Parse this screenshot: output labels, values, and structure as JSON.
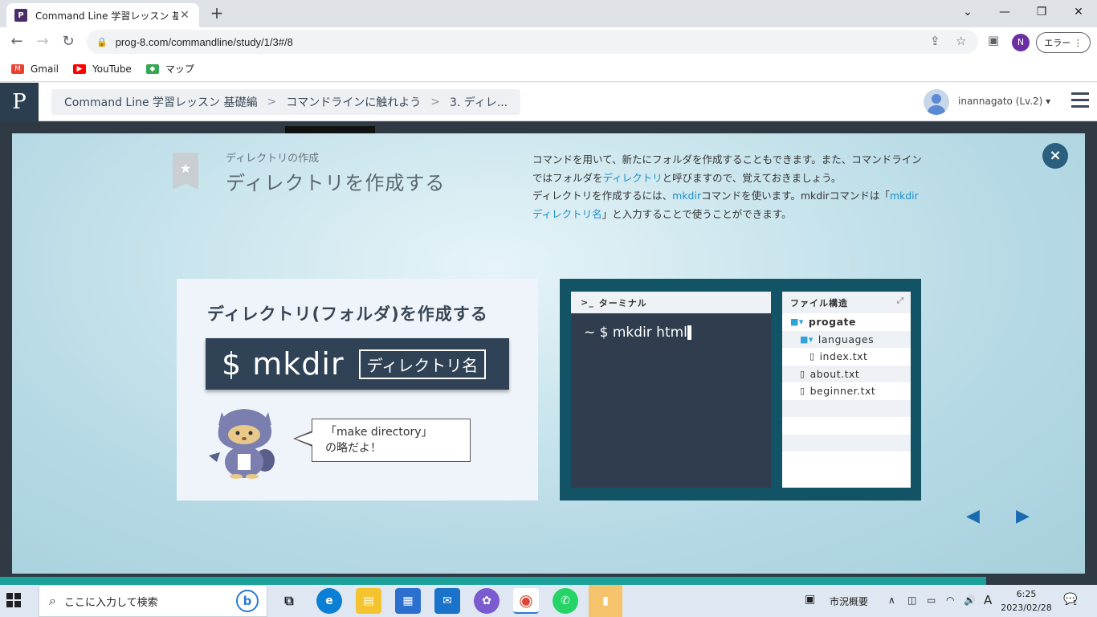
{
  "browser": {
    "tab_title": "Command Line 学習レッスン 基礎編 | Progate",
    "tab_close": "✕",
    "new_tab": "+",
    "url": "prog-8.com/commandline/study/1/3#/8",
    "error_button": "エラー",
    "profile_initial": "N",
    "window": {
      "minimize": "—",
      "maximize": "❐",
      "close": "✕",
      "tabsearch": "⌄"
    },
    "bookmarks": [
      {
        "label": "Gmail",
        "icon": "gmail-icon",
        "color": "#ea4335"
      },
      {
        "label": "YouTube",
        "icon": "youtube-icon",
        "color": "#ff0000"
      },
      {
        "label": "マップ",
        "icon": "maps-icon",
        "color": "#34a853"
      }
    ]
  },
  "app": {
    "logo": "P",
    "breadcrumb": [
      "Command Line 学習レッスン 基礎編",
      "コマンドラインに触れよう",
      "3. ディレ..."
    ],
    "username": "inannagato (Lv.2) ▾"
  },
  "slide": {
    "subtitle": "ディレクトリの作成",
    "title": "ディレクトリを作成する",
    "desc": {
      "p1_a": "コマンドを用いて、新たにフォルダを作成することもできます。また、コマンドラインではフォルダを",
      "p1_link": "ディレクトリ",
      "p1_b": "と呼びますので、覚えておきましょう。",
      "p2_a": "ディレクトリを作成するには、",
      "p2_link1": "mkdir",
      "p2_b": "コマンドを使います。mkdirコマンドは「",
      "p2_link2": "mkdir ディレクトリ名",
      "p2_c": "」と入力することで使うことができます。"
    },
    "left_heading": "ディレクトリ(フォルダ)を作成する",
    "command": "$ mkdir",
    "command_arg": "ディレクトリ名",
    "bubble_line1": "「make directory」",
    "bubble_line2": "の略だよ！",
    "terminal_title": "ターミナル",
    "terminal_prompt": "~ $ mkdir html",
    "files_title": "ファイル構造",
    "files": [
      {
        "name": "progate",
        "type": "folder",
        "level": 0
      },
      {
        "name": "languages",
        "type": "folder",
        "level": 1
      },
      {
        "name": "index.txt",
        "type": "file",
        "level": 2
      },
      {
        "name": "about.txt",
        "type": "file",
        "level": 1
      },
      {
        "name": "beginner.txt",
        "type": "file",
        "level": 1
      },
      {
        "name": "",
        "type": "empty",
        "level": 0
      },
      {
        "name": "",
        "type": "empty",
        "level": 0
      },
      {
        "name": "",
        "type": "empty",
        "level": 0
      },
      {
        "name": "",
        "type": "empty",
        "level": 0
      }
    ],
    "close_label": "×",
    "prev": "◀",
    "next": "▶"
  },
  "taskbar": {
    "search_placeholder": "ここに入力して検索",
    "weather": "市況概要",
    "ime": "A",
    "time": "6:25",
    "date": "2023/02/28",
    "notifications": "1"
  }
}
